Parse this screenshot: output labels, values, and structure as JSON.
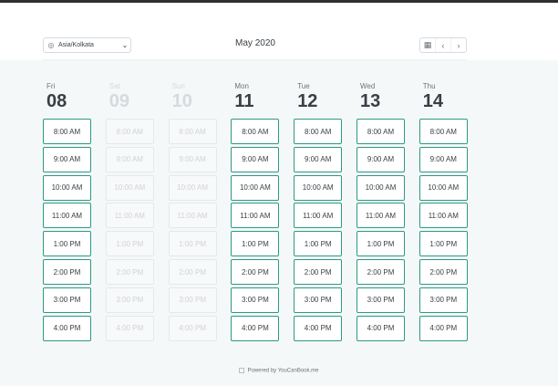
{
  "header": {
    "timezone": "Asia/Kolkata",
    "month": "May 2020",
    "icons": {
      "timezone": "globe-icon",
      "chevron": "chevron-down-icon",
      "calendar": "calendar-icon",
      "prev": "chevron-left-icon",
      "next": "chevron-right-icon"
    }
  },
  "days": [
    {
      "name": "Fri",
      "num": "08",
      "available": true,
      "slots": [
        "8:00 AM",
        "9:00 AM",
        "10:00 AM",
        "11:00 AM",
        "1:00 PM",
        "2:00 PM",
        "3:00 PM",
        "4:00 PM"
      ]
    },
    {
      "name": "Sat",
      "num": "09",
      "available": false,
      "slots": [
        "8:00 AM",
        "9:00 AM",
        "10:00 AM",
        "11:00 AM",
        "1:00 PM",
        "2:00 PM",
        "3:00 PM",
        "4:00 PM"
      ]
    },
    {
      "name": "Sun",
      "num": "10",
      "available": false,
      "slots": [
        "8:00 AM",
        "9:00 AM",
        "10:00 AM",
        "11:00 AM",
        "1:00 PM",
        "2:00 PM",
        "3:00 PM",
        "4:00 PM"
      ]
    },
    {
      "name": "Mon",
      "num": "11",
      "available": true,
      "slots": [
        "8:00 AM",
        "9:00 AM",
        "10:00 AM",
        "11:00 AM",
        "1:00 PM",
        "2:00 PM",
        "3:00 PM",
        "4:00 PM"
      ]
    },
    {
      "name": "Tue",
      "num": "12",
      "available": true,
      "slots": [
        "8:00 AM",
        "9:00 AM",
        "10:00 AM",
        "11:00 AM",
        "1:00 PM",
        "2:00 PM",
        "3:00 PM",
        "4:00 PM"
      ]
    },
    {
      "name": "Wed",
      "num": "13",
      "available": true,
      "slots": [
        "8:00 AM",
        "9:00 AM",
        "10:00 AM",
        "11:00 AM",
        "1:00 PM",
        "2:00 PM",
        "3:00 PM",
        "4:00 PM"
      ]
    },
    {
      "name": "Thu",
      "num": "14",
      "available": true,
      "slots": [
        "8:00 AM",
        "9:00 AM",
        "10:00 AM",
        "11:00 AM",
        "1:00 PM",
        "2:00 PM",
        "3:00 PM",
        "4:00 PM"
      ]
    }
  ],
  "footer": {
    "text": "Powered by YouCanBook.me"
  },
  "colors": {
    "accent": "#2b9a83",
    "panel": "#f5f8f9",
    "text": "#3a3f44",
    "disabled": "#cfd4d7"
  }
}
